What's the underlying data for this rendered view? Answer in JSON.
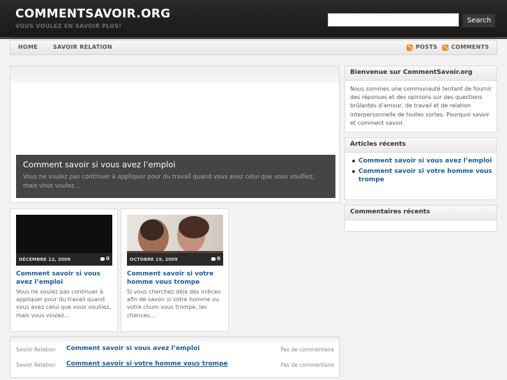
{
  "header": {
    "site_title": "COMMENTSAVOIR.ORG",
    "tagline": "VOUS VOULEZ EN SAVOIR PLUS!",
    "search_value": "",
    "search_button": "Search"
  },
  "nav": {
    "items": [
      "HOME",
      "SAVOIR RELATION"
    ],
    "feeds": [
      "POSTS",
      "COMMENTS"
    ],
    "feed_icon": "rss-icon"
  },
  "featured": {
    "title": "Comment savoir si vous avez l’emploi",
    "excerpt": "Vous ne voulez pas continuer à appliquer pour du travail quand vous avez celui que vous voulliez, mais vous voulez…"
  },
  "cards": [
    {
      "date": "DÉCEMBRE 12, 2009",
      "comments": "0",
      "title": "Comment savoir si vous avez l’emploi",
      "excerpt": "Vous ne voulez pas continuer à appliquer pour du travail quand vous avez celui que vous voulliez, mais vous voulez…"
    },
    {
      "date": "OCTOBRE 19, 2009",
      "comments": "0",
      "title": "Comment savoir si votre homme vous trompe",
      "excerpt": "Si vous cherchez déjà des indices afin de savoir si votre homme ou votre chum vous trompe, les chances…"
    }
  ],
  "recent_list": [
    {
      "category": "Savoir Relation",
      "title": "Comment savoir si vous avez l’emploi",
      "comments": "Pas de commentaire"
    },
    {
      "category": "Savoir Relation",
      "title": "Comment savoir si votre homme vous trompe",
      "comments": "Pas de commentaire"
    }
  ],
  "sidebar": {
    "welcome_title": "Bienvenue sur CommentSavoir.org",
    "welcome_text": "Nous sommes une communauté tentant de fournir des réponses et des opinions sur des questions brûlantes d’amour, de travail et de relation interpersonnelle de toutes sortes. Pourquoi savoir et comment savoir.",
    "recent_articles_title": "Articles récents",
    "recent_articles": [
      "Comment savoir si vous avez l’emploi",
      "Comment savoir si votre homme vous trompe"
    ],
    "recent_comments_title": "Commentaires récents"
  },
  "colors": {
    "header_bg": "#1f1d1c",
    "link": "#1b5b96",
    "feed_icon": "#f48b1e"
  }
}
